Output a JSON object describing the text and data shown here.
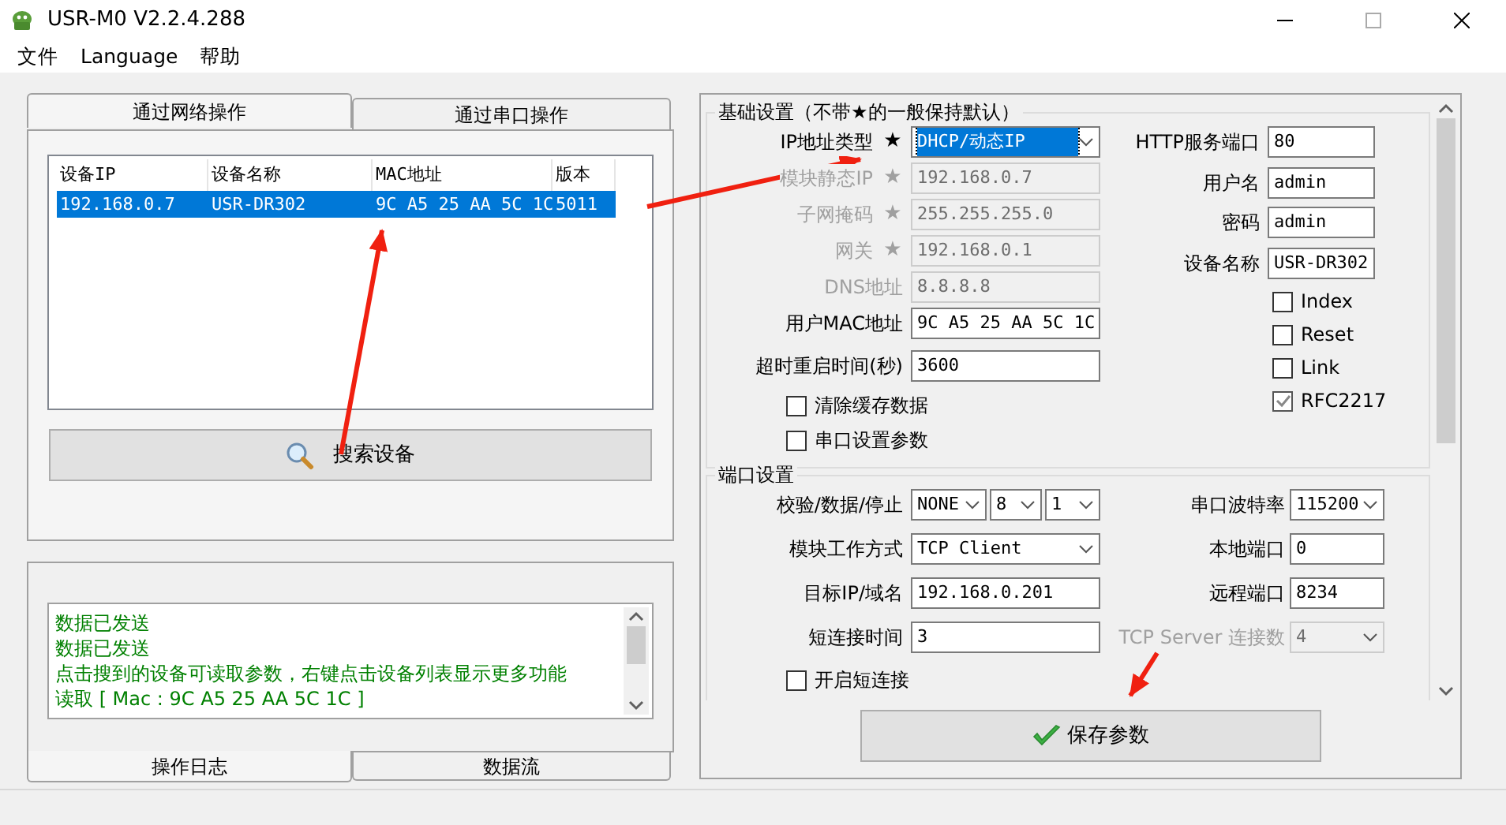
{
  "window": {
    "title": "USR-M0 V2.2.4.288"
  },
  "menu": [
    "文件",
    "Language",
    "帮助"
  ],
  "device_tabs": [
    {
      "label": "通过网络操作",
      "selected": true
    },
    {
      "label": "通过串口操作",
      "selected": false
    }
  ],
  "device_table": {
    "columns": [
      "设备IP",
      "设备名称",
      "MAC地址",
      "版本"
    ],
    "rows": [
      {
        "cells": [
          "192.168.0.7",
          "USR-DR302",
          "9C A5 25 AA 5C 1C",
          "5011"
        ],
        "selected": true
      }
    ]
  },
  "search_button": "搜索设备",
  "log": {
    "lines": [
      "数据已发送",
      "数据已发送",
      "点击搜到的设备可读取参数，右键点击设备列表显示更多功能",
      "读取 [ Mac : 9C A5 25 AA 5C 1C ]"
    ],
    "tabs": [
      {
        "label": "操作日志",
        "selected": true
      },
      {
        "label": "数据流",
        "selected": false
      }
    ]
  },
  "basic_settings": {
    "title": "基础设置（不带★的一般保持默认）",
    "fields": [
      {
        "label": "IP地址类型",
        "star": "★",
        "disabled": false,
        "controls": [
          {
            "kind": "select",
            "value": "DHCP/动态IP",
            "focused": true
          }
        ]
      },
      {
        "label": "模块静态IP",
        "star": "★",
        "disabled": true,
        "controls": [
          {
            "kind": "input",
            "value": "192.168.0.7"
          }
        ]
      },
      {
        "label": "子网掩码",
        "star": "★",
        "disabled": true,
        "controls": [
          {
            "kind": "input",
            "value": "255.255.255.0"
          }
        ]
      },
      {
        "label": "网关",
        "star": "★",
        "disabled": true,
        "controls": [
          {
            "kind": "input",
            "value": "192.168.0.1"
          }
        ]
      },
      {
        "label": "DNS地址",
        "disabled": true,
        "controls": [
          {
            "kind": "input",
            "value": "8.8.8.8"
          }
        ]
      },
      {
        "label": "用户MAC地址",
        "disabled": false,
        "controls": [
          {
            "kind": "input",
            "value": "9C A5 25 AA 5C 1C"
          }
        ]
      },
      {
        "label": "超时重启时间(秒)",
        "disabled": false,
        "controls": [
          {
            "kind": "input",
            "value": "3600"
          }
        ]
      }
    ],
    "options": [
      {
        "label": "清除缓存数据",
        "checked": false
      },
      {
        "label": "串口设置参数",
        "checked": false
      }
    ],
    "right_fields": [
      {
        "label": "HTTP服务端口",
        "disabled": false,
        "controls": [
          {
            "kind": "input",
            "value": "80"
          }
        ]
      },
      {
        "label": "用户名",
        "disabled": false,
        "controls": [
          {
            "kind": "input",
            "value": "admin"
          }
        ]
      },
      {
        "label": "密码",
        "disabled": false,
        "controls": [
          {
            "kind": "input",
            "value": "admin"
          }
        ]
      },
      {
        "label": "设备名称",
        "disabled": false,
        "controls": [
          {
            "kind": "input",
            "value": "USR-DR302"
          }
        ]
      }
    ],
    "flags": [
      {
        "label": "Index",
        "checked": false
      },
      {
        "label": "Reset",
        "checked": false
      },
      {
        "label": "Link",
        "checked": false
      },
      {
        "label": "RFC2217",
        "checked": true
      }
    ]
  },
  "port_settings": {
    "title": "端口设置",
    "fields": [
      {
        "label": "校验/数据/停止",
        "disabled": false,
        "controls": [
          {
            "kind": "select",
            "value": "NONE"
          },
          {
            "kind": "select",
            "value": "8"
          },
          {
            "kind": "select",
            "value": "1"
          }
        ]
      },
      {
        "label": "模块工作方式",
        "disabled": false,
        "controls": [
          {
            "kind": "select",
            "value": "TCP Client"
          }
        ]
      },
      {
        "label": "目标IP/域名",
        "disabled": false,
        "controls": [
          {
            "kind": "input",
            "value": "192.168.0.201"
          }
        ]
      },
      {
        "label": "短连接时间",
        "disabled": false,
        "controls": [
          {
            "kind": "input",
            "value": "3"
          }
        ]
      }
    ],
    "options": [
      {
        "label": "开启短连接",
        "checked": false
      }
    ],
    "right_fields": [
      {
        "label": "串口波特率",
        "disabled": false,
        "controls": [
          {
            "kind": "select",
            "value": "115200"
          }
        ]
      },
      {
        "label": "本地端口",
        "disabled": false,
        "controls": [
          {
            "kind": "input",
            "value": "0"
          }
        ]
      },
      {
        "label": "远程端口",
        "disabled": false,
        "controls": [
          {
            "kind": "input",
            "value": "8234"
          }
        ]
      },
      {
        "label": "TCP Server 连接数",
        "disabled": true,
        "controls": [
          {
            "kind": "select",
            "value": "4"
          }
        ]
      }
    ]
  },
  "save_button": "保存参数"
}
